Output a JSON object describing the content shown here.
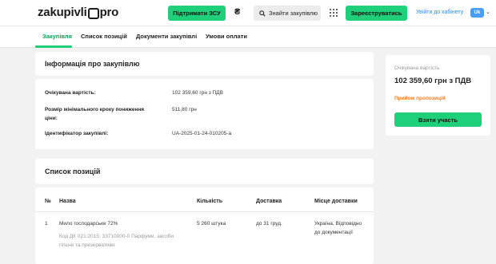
{
  "header": {
    "logo_left": "zakupivli",
    "logo_right": "pro",
    "support_button": "Підтримати ЗСУ",
    "currency_symbol": "₴",
    "search_button": "Знайти закупівлю",
    "register_button": "Зареєструватись",
    "cabinet_link": "Увійти до кабінету",
    "language": "Uk"
  },
  "tabs": [
    {
      "label": "Закупівля",
      "active": true
    },
    {
      "label": "Список позицій",
      "active": false
    },
    {
      "label": "Документи закупівлі",
      "active": false
    },
    {
      "label": "Умови оплати",
      "active": false
    }
  ],
  "info": {
    "title": "Інформація про закупівлю",
    "rows": [
      {
        "label": "Очікувана вартість:",
        "value": "102 359,60 грн з ПДВ"
      },
      {
        "label_line1": "Розмір мінімального кроку пониження",
        "label_line2": "ціни:",
        "value": "511,80 грн"
      },
      {
        "label": "Ідентифікатор закупівлі:",
        "value": "UA-2025-01-24-010205-a"
      }
    ]
  },
  "positions": {
    "title": "Список позицій",
    "columns": [
      "№",
      "Назва",
      "Кількість",
      "Доставка",
      "Місце доставки"
    ],
    "items": [
      {
        "num": "1",
        "name": "Мило господарське 72%",
        "code_line1": "Код ДК 021:2015: 33710000-0 Парфуми, засоби",
        "code_line2": "гігієни та презервативи",
        "quantity": "5 260 штука",
        "delivery": "до 31 груд.",
        "place_line1": "Україна, Відповідно",
        "place_line2": "до документації"
      }
    ]
  },
  "side": {
    "label": "Очікувана вартість",
    "value": "102 359,60 грн з ПДВ",
    "status": "Прийом пропозицій",
    "button": "Взяти участь"
  },
  "colors": {
    "accent_green": "#1fd07a",
    "active_tab": "#1a9d57",
    "status_orange": "#f07d22",
    "link_blue": "#2a8df0"
  }
}
